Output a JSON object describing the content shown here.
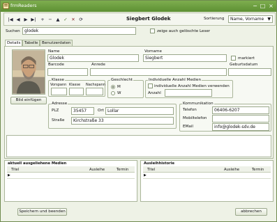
{
  "window": {
    "title": "frmReaders"
  },
  "toolbar": {
    "nav_buttons": [
      "|◀",
      "◀",
      "▶",
      "▶|",
      "+",
      "−",
      "▲",
      "✓",
      "✕",
      "⟳"
    ],
    "record_title": "Siegbert Glodek",
    "sort_label": "Sortierung",
    "sort_value": "Name, Vorname"
  },
  "search": {
    "label": "Suchen",
    "value": "glodek",
    "show_deleted_label": "zeige auch gelöschte Leser"
  },
  "tabs": [
    "Details",
    "Tabelle",
    "Benutzerdaten"
  ],
  "details": {
    "photo_button": "Bild einfügen",
    "name_label": "Name",
    "name_value": "Glodek",
    "vorname_label": "Vorname",
    "vorname_value": "Siegbert",
    "markiert_label": "markiert",
    "barcode_label": "Barcode",
    "barcode_value": "",
    "anrede_label": "Anrede",
    "anrede_value": "",
    "geburtsdatum_label": "Geburtsdatum",
    "geburtsdatum_value": "",
    "klasse": {
      "title": "Klasse",
      "col1": "Vorspann",
      "col2": "Klasse",
      "col3": "Nachspann"
    },
    "geschlecht": {
      "title": "Geschlecht",
      "m": "M",
      "w": "W",
      "selected": "M"
    },
    "medien": {
      "title": "Individuelle Anzahl Medien",
      "use_label": "individuelle Anzahl Medien verwenden",
      "anzahl_label": "Anzahl"
    },
    "adresse": {
      "title": "Adresse",
      "plz_label": "PLZ",
      "plz_value": "35457",
      "ort_label": "Ort",
      "ort_value": "Lollar",
      "strasse_label": "Straße",
      "strasse_value": "Kirchstraße 33"
    },
    "kommunikation": {
      "title": "Kommunikation",
      "telefon_label": "Telefon",
      "telefon_value": "06406-6207",
      "mobil_label": "Mobiltelefon",
      "mobil_value": "",
      "email_label": "EMail",
      "email_value": "info@glodek-sdv.de"
    }
  },
  "loans": {
    "title": "aktuell ausgeliehene Medien",
    "columns": [
      "Titel",
      "Ausleihe",
      "Termin"
    ]
  },
  "history": {
    "title": "Ausleihhistorie",
    "columns": [
      "Titel",
      "Ausleihe",
      "Termin"
    ]
  },
  "footer": {
    "save_label": "Speichern und beenden",
    "cancel_label": "abbrechen"
  },
  "colors": {
    "titlebar": "#6a9c3c",
    "panel_bg": "#f7f9f3",
    "window_bg": "#eef2e6"
  }
}
